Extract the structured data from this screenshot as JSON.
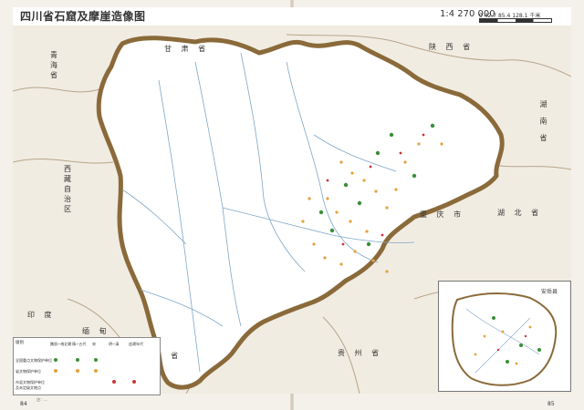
{
  "title": "四川省石窟及摩崖造像图",
  "scale": {
    "ratio": "1:4 270 000",
    "ticks": "0   42.7   85.4  128.1 千米"
  },
  "map_labels": {
    "qinghai": [
      "青",
      "海",
      "省"
    ],
    "xizang": [
      "西",
      "藏",
      "自",
      "治",
      "区"
    ],
    "gansu": "甘 肃 省",
    "shaanxi": "陕 西 省",
    "hubei": "湖 北 省",
    "chongqing": "重 庆 市",
    "yunnan": "云 南 省",
    "guizhou": "贵 州 省",
    "india": "印 度",
    "myanmar": "缅 甸",
    "hunan": "湖 南 省"
  },
  "inset": {
    "title": "安岳县"
  },
  "legend": {
    "header": "级别",
    "columns": [
      "魏晋~南北朝",
      "隋~五代",
      "宋",
      "明~清",
      "追溯年代"
    ],
    "rows": [
      "全国重点文物保护单位",
      "省文物保护单位",
      "市县文物保护单位及未定级文物点"
    ]
  },
  "footnote": "注：...",
  "pages": {
    "left": "84",
    "right": "85"
  },
  "colors": {
    "sichuan_fill": "#ffffff",
    "neighbor_fill": "#f1ece2",
    "border_brown": "#8a6a3a",
    "river_blue": "#7fa7c9",
    "site_green": "#3a8f3a",
    "site_orange": "#e6a23c",
    "site_red": "#cc3333"
  }
}
